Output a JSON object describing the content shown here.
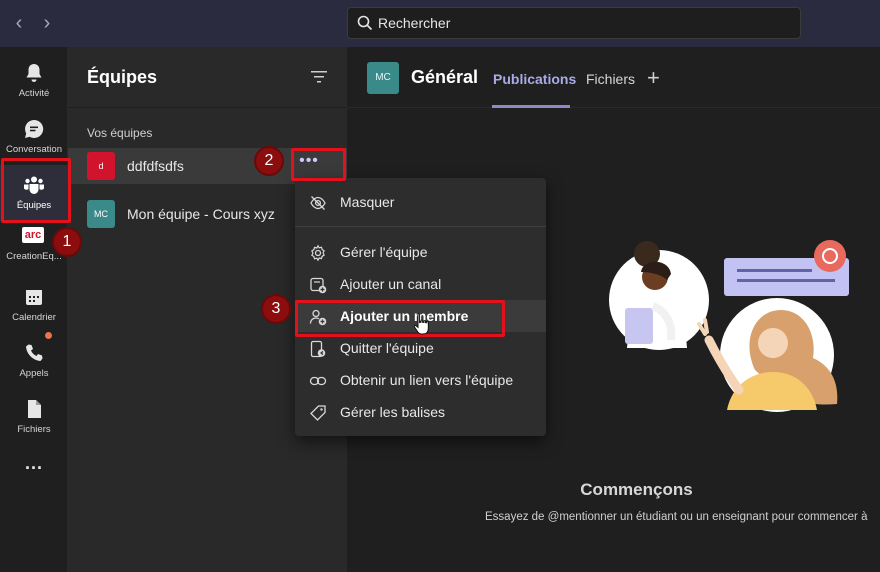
{
  "search": {
    "placeholder": "Rechercher"
  },
  "rail": {
    "items": [
      {
        "label": "Activité",
        "icon": "bell-icon"
      },
      {
        "label": "Conversation",
        "icon": "chat-icon"
      },
      {
        "label": "Équipes",
        "icon": "teams-icon",
        "active": true
      },
      {
        "label": "CreationEq...",
        "icon": "app-logo-icon",
        "logo_text": "arc"
      },
      {
        "label": "Calendrier",
        "icon": "calendar-icon"
      },
      {
        "label": "Appels",
        "icon": "phone-icon",
        "badge_color": "#e97548"
      },
      {
        "label": "Fichiers",
        "icon": "file-icon"
      },
      {
        "label": "...",
        "icon": "more-apps-icon"
      }
    ]
  },
  "panel": {
    "title": "Équipes",
    "section_label": "Vos équipes",
    "teams": [
      {
        "avatar": "d",
        "avatar_color": "#d2132c",
        "name": "ddfdfsdfs"
      },
      {
        "avatar": "MC",
        "avatar_color": "#3a8a8a",
        "name": "Mon équipe - Cours xyz"
      }
    ],
    "more_label": "•••"
  },
  "main": {
    "channel_avatar": "MC",
    "channel_title": "Général",
    "tabs": [
      {
        "label": "Publications",
        "active": true
      },
      {
        "label": "Fichiers",
        "active": false
      }
    ],
    "add_tab_label": "+",
    "welcome_title": "Commençons",
    "welcome_sub": "Essayez de @mentionner un étudiant ou un enseignant pour commencer à"
  },
  "menu": {
    "items": [
      {
        "label": "Masquer",
        "icon": "eye-off-icon"
      },
      {
        "label": "Gérer l'équipe",
        "icon": "gear-icon"
      },
      {
        "label": "Ajouter un canal",
        "icon": "add-channel-icon"
      },
      {
        "label": "Ajouter un membre",
        "icon": "add-person-icon",
        "highlighted": true
      },
      {
        "label": "Quitter l'équipe",
        "icon": "leave-icon"
      },
      {
        "label": "Obtenir un lien vers l'équipe",
        "icon": "link-icon"
      },
      {
        "label": "Gérer les balises",
        "icon": "tag-icon"
      }
    ]
  },
  "annotations": {
    "steps": [
      "1",
      "2",
      "3"
    ],
    "color": "#e3111b"
  }
}
